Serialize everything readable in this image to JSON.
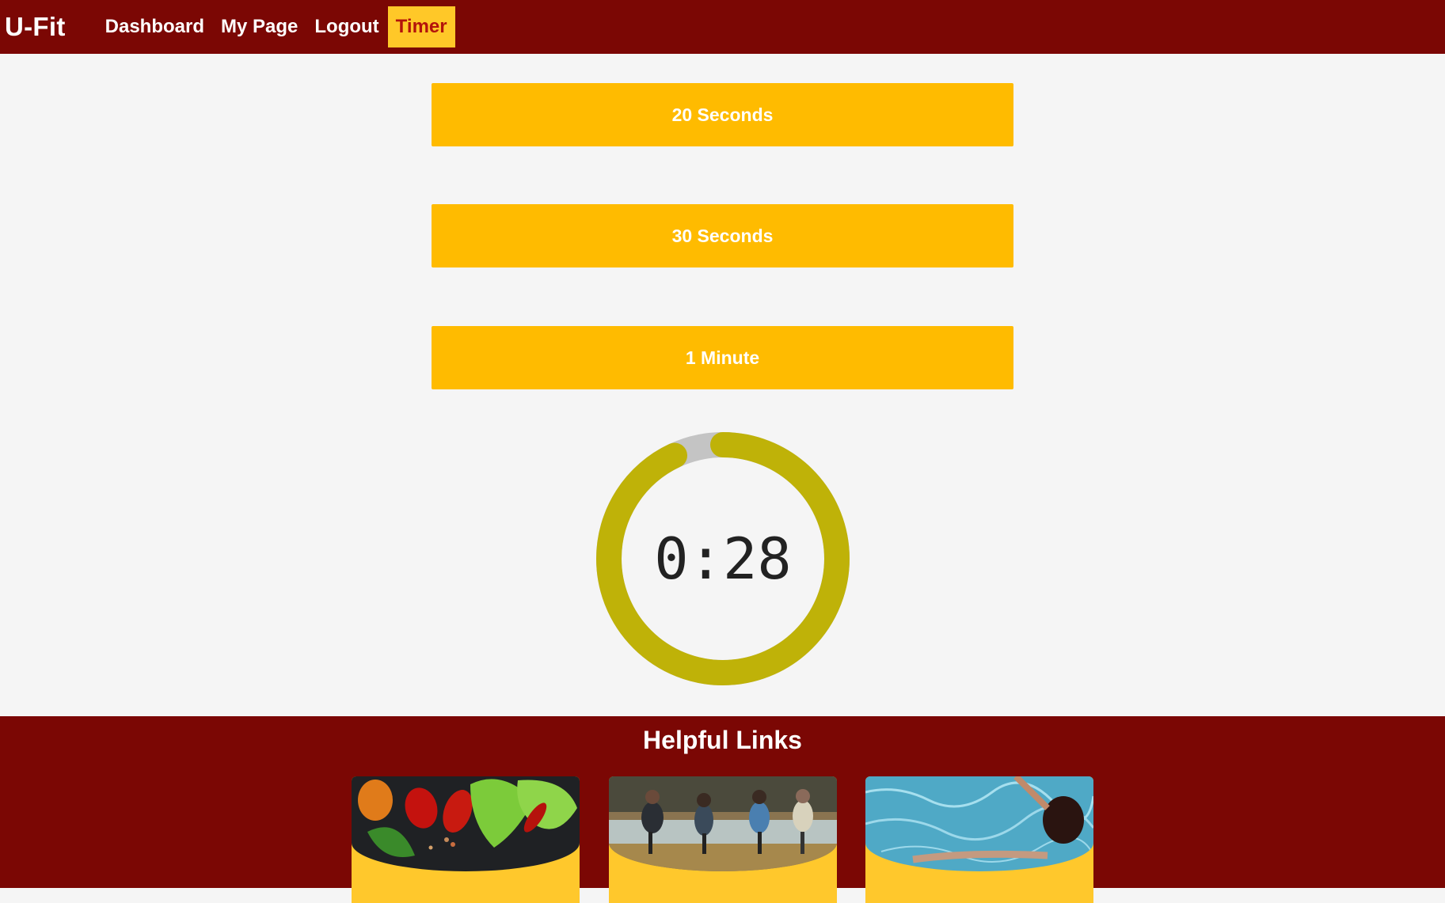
{
  "nav": {
    "brand": "U-Fit",
    "links": [
      "Dashboard",
      "My Page",
      "Logout"
    ],
    "active_link": "Timer"
  },
  "buttons": [
    "20 Seconds",
    "30 Seconds",
    "1 Minute"
  ],
  "timer": {
    "display": "0:28",
    "progress_fraction": 0.93
  },
  "footer": {
    "title": "Helpful Links",
    "cards": [
      {
        "image": "vegetables-photo"
      },
      {
        "image": "group-running-photo"
      },
      {
        "image": "swimmer-pool-photo"
      }
    ]
  },
  "colors": {
    "brand_red": "#7b0704",
    "button_yellow": "#ffbb00",
    "card_yellow": "#ffc82c",
    "timer_ring": "#bfb208",
    "timer_track": "#c4c4c4"
  }
}
